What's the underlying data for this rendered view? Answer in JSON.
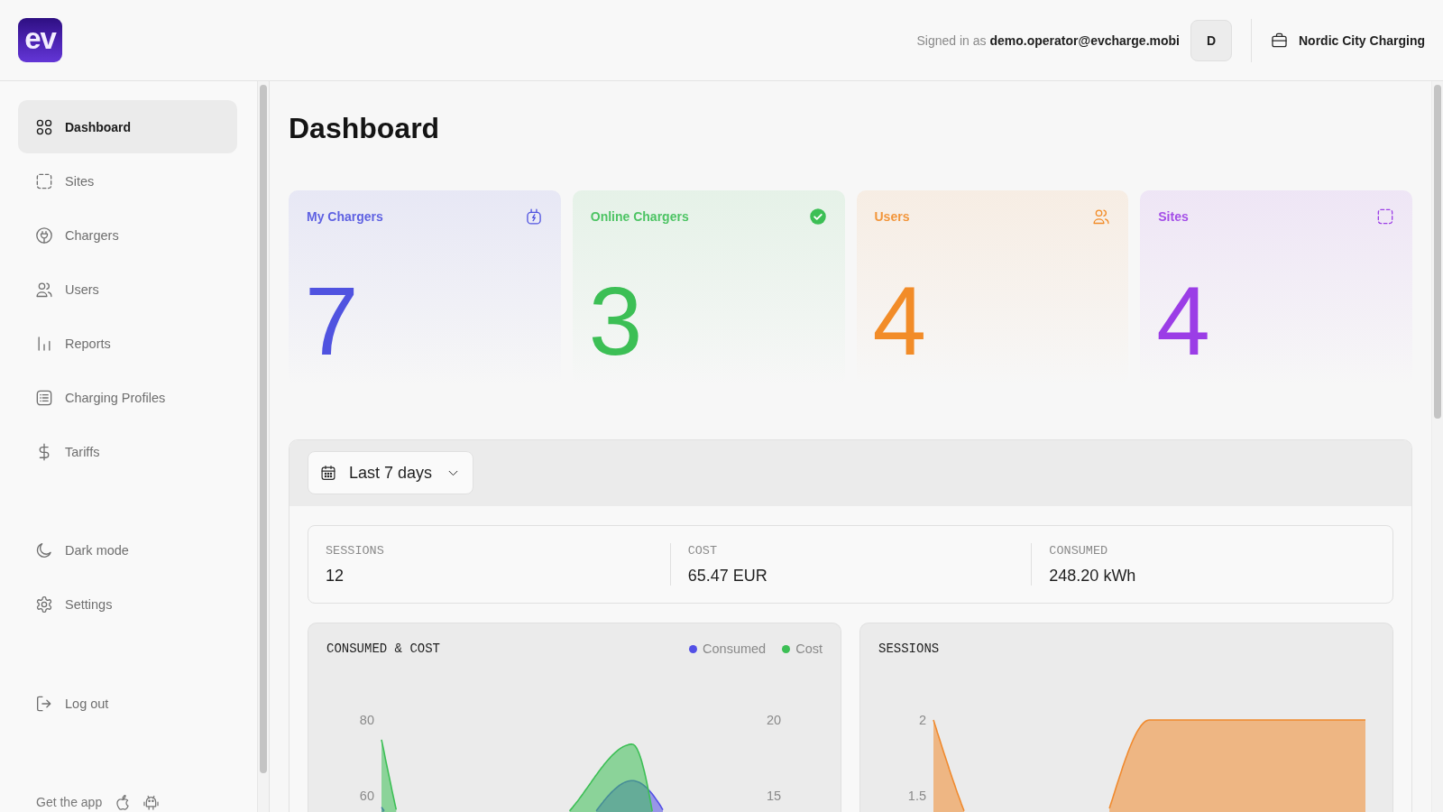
{
  "header": {
    "logo": "ev",
    "signed_in_label": "Signed in as",
    "user_email": "demo.operator@evcharge.mobi",
    "avatar_initial": "D",
    "organization": "Nordic City Charging"
  },
  "sidebar": {
    "items": [
      {
        "label": "Dashboard",
        "selected": true
      },
      {
        "label": "Sites",
        "selected": false
      },
      {
        "label": "Chargers",
        "selected": false
      },
      {
        "label": "Users",
        "selected": false
      },
      {
        "label": "Reports",
        "selected": false
      },
      {
        "label": "Charging Profiles",
        "selected": false
      },
      {
        "label": "Tariffs",
        "selected": false
      }
    ],
    "preferences": [
      {
        "label": "Dark mode"
      },
      {
        "label": "Settings"
      }
    ],
    "logout": {
      "label": "Log out"
    },
    "app_promo": {
      "label": "Get the app"
    }
  },
  "page": {
    "title": "Dashboard"
  },
  "stat_cards": [
    {
      "title": "My Chargers",
      "value": "7",
      "color": "#5053e0"
    },
    {
      "title": "Online Chargers",
      "value": "3",
      "color": "#3cbf55"
    },
    {
      "title": "Users",
      "value": "4",
      "color": "#f28c28"
    },
    {
      "title": "Sites",
      "value": "4",
      "color": "#9b3de6"
    }
  ],
  "report": {
    "period_dropdown": {
      "label": "Last 7 days"
    },
    "summary": [
      {
        "label": "SESSIONS",
        "value": "12"
      },
      {
        "label": "COST",
        "value": "65.47 EUR"
      },
      {
        "label": "CONSUMED",
        "value": "248.20 kWh"
      }
    ],
    "charts": [
      {
        "title": "CONSUMED & COST",
        "legend": [
          {
            "label": "Consumed",
            "color": "#5350e6"
          },
          {
            "label": "Cost",
            "color": "#3cbf55"
          }
        ],
        "left_axis_labels": [
          "80",
          "60"
        ],
        "right_axis_labels": [
          "20",
          "15"
        ]
      },
      {
        "title": "SESSIONS",
        "left_axis_labels": [
          "2",
          "1.5"
        ]
      }
    ]
  }
}
